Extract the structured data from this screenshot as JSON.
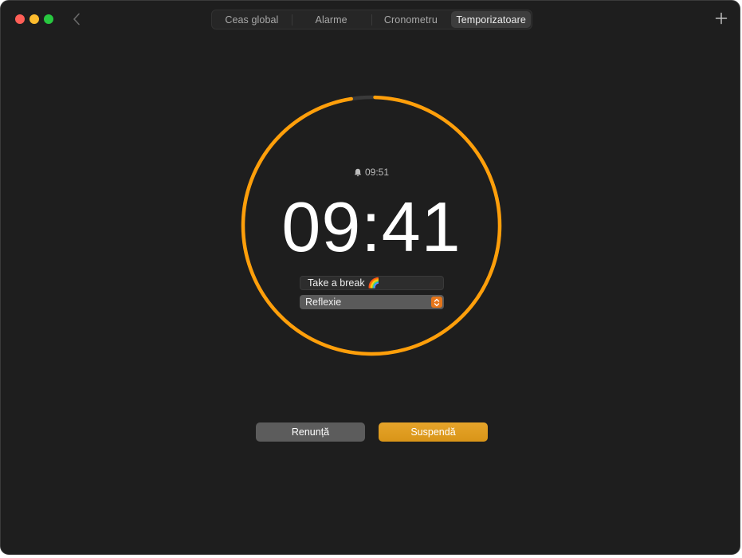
{
  "window": {
    "tabs": [
      {
        "label": "Ceas global"
      },
      {
        "label": "Alarme"
      },
      {
        "label": "Cronometru"
      },
      {
        "label": "Temporizatoare"
      }
    ],
    "active_tab": "Temporizatoare"
  },
  "timer": {
    "alarm_time": "09:51",
    "remaining": "09:41",
    "progress_remaining": 0.97,
    "label": "Take a break 🌈",
    "sound": "Reflexie"
  },
  "buttons": {
    "cancel": "Renunță",
    "pause": "Suspendă"
  },
  "colors": {
    "accent": "#ff9f0a",
    "track": "#3a3a3a",
    "background": "#1e1e1e",
    "pause_button": "#e0a026"
  },
  "icons": {
    "back": "chevron-left-icon",
    "add": "plus-icon",
    "bell": "bell-icon",
    "select": "up-down-chevron-icon"
  }
}
